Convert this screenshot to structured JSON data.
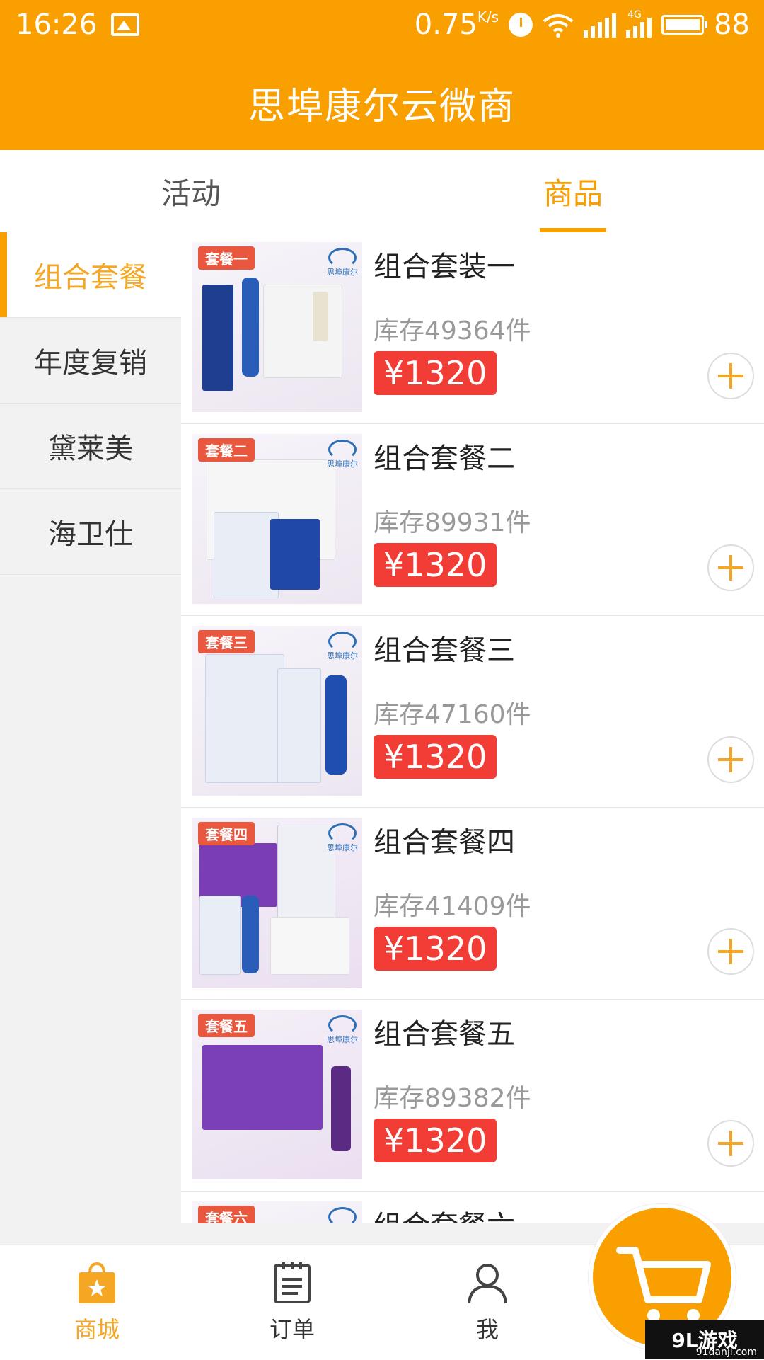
{
  "status_bar": {
    "time": "16:26",
    "network_speed": "0.75",
    "speed_unit": "K/s",
    "network_type": "4G",
    "battery": "88"
  },
  "app": {
    "title": "思埠康尔云微商"
  },
  "tabs": [
    {
      "label": "活动",
      "active": false
    },
    {
      "label": "商品",
      "active": true
    }
  ],
  "sidebar": {
    "categories": [
      {
        "label": "组合套餐",
        "active": true
      },
      {
        "label": "年度复销",
        "active": false
      },
      {
        "label": "黛莱美",
        "active": false
      },
      {
        "label": "海卫仕",
        "active": false
      }
    ]
  },
  "products": [
    {
      "tag": "套餐一",
      "name": "组合套装一",
      "stock": "库存49364件",
      "price": "¥1320"
    },
    {
      "tag": "套餐二",
      "name": "组合套餐二",
      "stock": "库存89931件",
      "price": "¥1320"
    },
    {
      "tag": "套餐三",
      "name": "组合套餐三",
      "stock": "库存47160件",
      "price": "¥1320"
    },
    {
      "tag": "套餐四",
      "name": "组合套餐四",
      "stock": "库存41409件",
      "price": "¥1320"
    },
    {
      "tag": "套餐五",
      "name": "组合套餐五",
      "stock": "库存89382件",
      "price": "¥1320"
    },
    {
      "tag": "套餐六",
      "name": "组合套餐六",
      "stock": "",
      "price": ""
    }
  ],
  "brand": {
    "logo_text": "思埠康尔"
  },
  "bottom_nav": [
    {
      "label": "商城",
      "icon": "shop-bag-icon",
      "active": true
    },
    {
      "label": "订单",
      "icon": "order-list-icon",
      "active": false
    },
    {
      "label": "我",
      "icon": "user-icon",
      "active": false
    }
  ],
  "cart": {
    "icon": "cart-icon"
  },
  "watermark": {
    "text": "9L游戏",
    "sub": "91danji.com"
  },
  "colors": {
    "primary": "#f9a000",
    "accent": "#f5a623",
    "price": "#f23c36",
    "tag": "#e9573f",
    "brand_blue": "#2d6fb7"
  }
}
